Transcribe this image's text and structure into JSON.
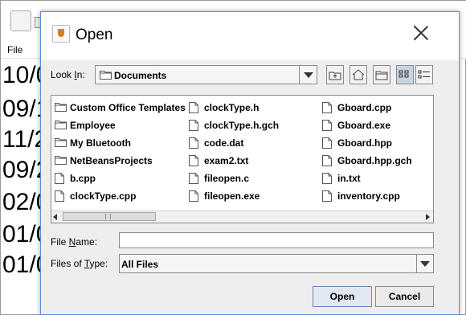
{
  "background": {
    "menu": {
      "file": "File"
    },
    "dates": [
      "10/0",
      "09/1",
      "11/2",
      "09/2",
      "02/0",
      "01/0",
      "01/0"
    ]
  },
  "dialog": {
    "title": "Open",
    "look_in": {
      "label_pre": "Look ",
      "label_mnemonic": "I",
      "label_post": "n:",
      "value": "Documents"
    },
    "toolbar": [
      {
        "name": "up-one-level-icon"
      },
      {
        "name": "home-icon"
      },
      {
        "name": "new-folder-icon"
      },
      {
        "name": "list-view-icon",
        "active": true
      },
      {
        "name": "details-view-icon"
      }
    ],
    "files": [
      {
        "name": "Custom Office Templates",
        "type": "folder"
      },
      {
        "name": "Employee",
        "type": "folder"
      },
      {
        "name": "My Bluetooth",
        "type": "folder"
      },
      {
        "name": "NetBeansProjects",
        "type": "folder"
      },
      {
        "name": "b.cpp",
        "type": "file"
      },
      {
        "name": "clockType.cpp",
        "type": "file"
      },
      {
        "name": "clockType.h",
        "type": "file"
      },
      {
        "name": "clockType.h.gch",
        "type": "file"
      },
      {
        "name": "code.dat",
        "type": "file"
      },
      {
        "name": "exam2.txt",
        "type": "file"
      },
      {
        "name": "fileopen.c",
        "type": "file"
      },
      {
        "name": "fileopen.exe",
        "type": "file"
      },
      {
        "name": "Gboard.cpp",
        "type": "file"
      },
      {
        "name": "Gboard.exe",
        "type": "file"
      },
      {
        "name": "Gboard.hpp",
        "type": "file"
      },
      {
        "name": "Gboard.hpp.gch",
        "type": "file"
      },
      {
        "name": "in.txt",
        "type": "file"
      },
      {
        "name": "inventory.cpp",
        "type": "file"
      }
    ],
    "file_name": {
      "label_pre": "File ",
      "label_mnemonic": "N",
      "label_post": "ame:",
      "value": ""
    },
    "files_of_type": {
      "label_pre": "Files of ",
      "label_mnemonic": "T",
      "label_post": "ype:",
      "value": "All Files"
    },
    "buttons": {
      "open": "Open",
      "cancel": "Cancel"
    }
  }
}
